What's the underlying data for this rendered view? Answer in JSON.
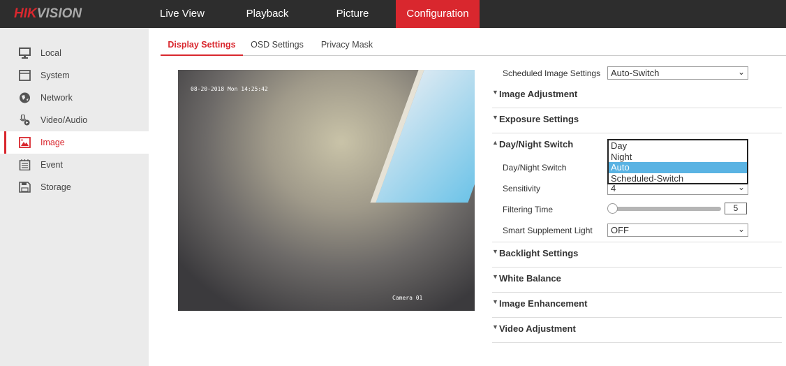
{
  "brand": {
    "logo_red": "HIK",
    "logo_gray": "VISION",
    "accent": "#d9272e"
  },
  "nav": [
    "Live View",
    "Playback",
    "Picture",
    "Configuration"
  ],
  "sidebar": [
    {
      "label": "Local",
      "icon": "monitor-icon"
    },
    {
      "label": "System",
      "icon": "window-icon"
    },
    {
      "label": "Network",
      "icon": "globe-icon"
    },
    {
      "label": "Video/Audio",
      "icon": "microphone-video-icon"
    },
    {
      "label": "Image",
      "icon": "image-icon",
      "active": true
    },
    {
      "label": "Event",
      "icon": "calendar-icon"
    },
    {
      "label": "Storage",
      "icon": "floppy-icon"
    }
  ],
  "tabs": [
    "Display Settings",
    "OSD Settings",
    "Privacy Mask"
  ],
  "video": {
    "timestamp": "08-20-2018 Mon 14:25:42",
    "camera_name": "Camera 01"
  },
  "settings": {
    "scheduled_label": "Scheduled Image Settings",
    "scheduled_value": "Auto-Switch",
    "sections": [
      "Image Adjustment",
      "Exposure Settings",
      "Day/Night Switch",
      "Backlight Settings",
      "White Balance",
      "Image Enhancement",
      "Video Adjustment"
    ],
    "daynight_label": "Day/Night Switch",
    "daynight_options": [
      "Day",
      "Night",
      "Auto",
      "Scheduled-Switch"
    ],
    "daynight_selected": "Auto",
    "sensitivity_label": "Sensitivity",
    "sensitivity_value": "4",
    "filtering_label": "Filtering Time",
    "filtering_value": "5",
    "supplement_label": "Smart Supplement Light",
    "supplement_value": "OFF"
  }
}
